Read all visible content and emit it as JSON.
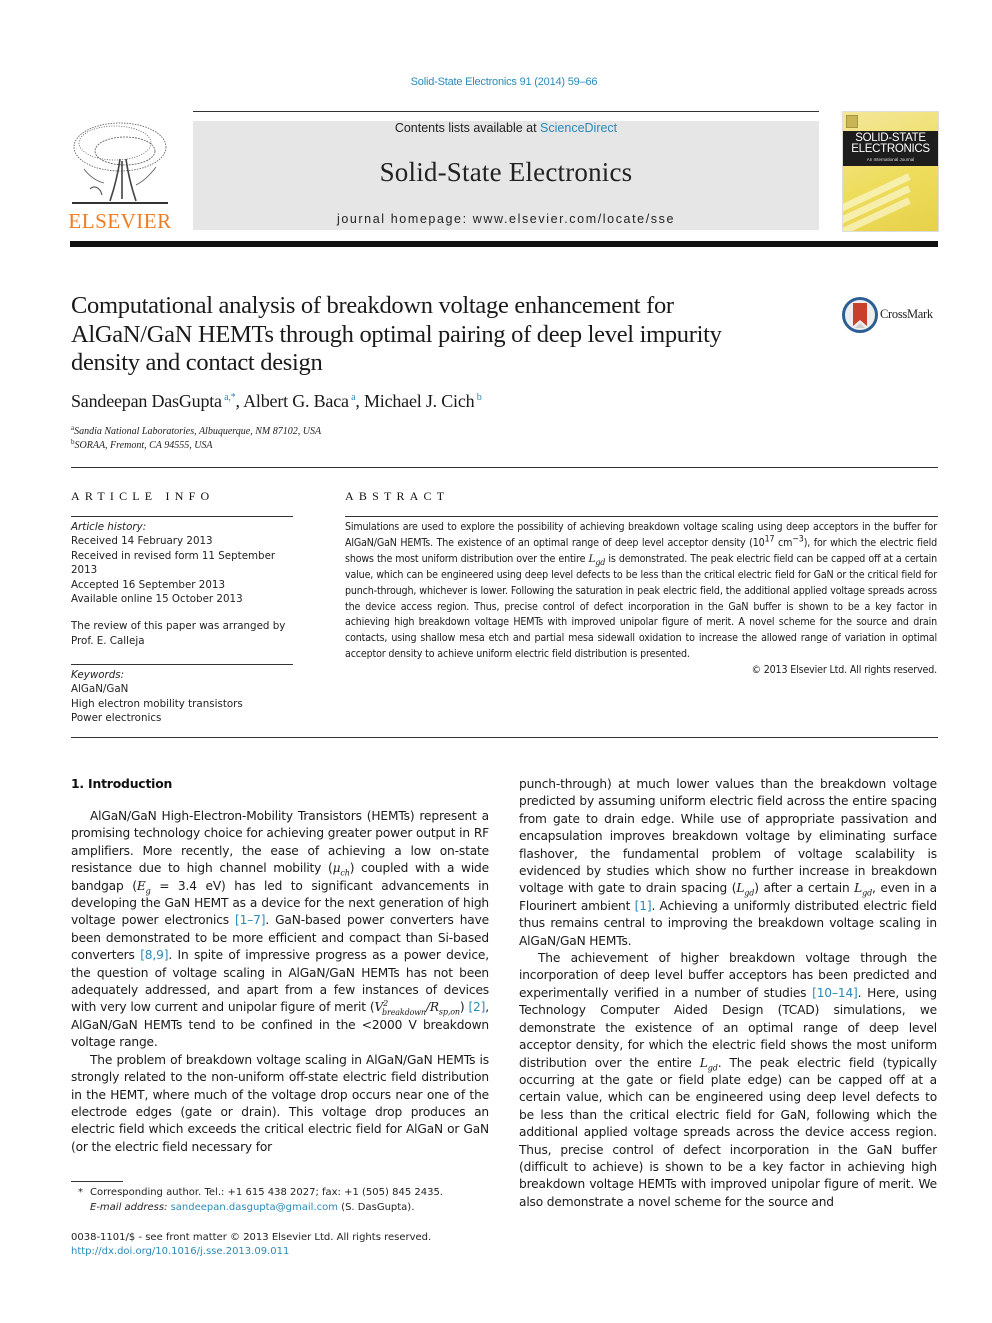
{
  "header": {
    "citation": "Solid-State Electronics 91 (2014) 59–66",
    "contents_prefix": "Contents lists available at ",
    "contents_link": "ScienceDirect",
    "journal_name": "Solid-State Electronics",
    "homepage_prefix": "journal homepage: ",
    "homepage_url": "www.elsevier.com/locate/sse",
    "publisher_logo_text": "ELSEVIER",
    "cover": {
      "title_line1": "SOLID-STATE",
      "title_line2": "ELECTRONICS",
      "subtitle": "An International Journal"
    }
  },
  "article": {
    "title": "Computational analysis of breakdown voltage enhancement for AlGaN/GaN HEMTs through optimal pairing of deep level impurity density and contact design",
    "crossmark_label": "CrossMark",
    "authors": [
      {
        "name": "Sandeepan DasGupta",
        "marks": "a,*"
      },
      {
        "name": "Albert G. Baca",
        "marks": "a"
      },
      {
        "name": "Michael J. Cich",
        "marks": "b"
      }
    ],
    "affiliations": [
      {
        "mark": "a",
        "text": "Sandia National Laboratories, Albuquerque, NM 87102, USA"
      },
      {
        "mark": "b",
        "text": "SORAA, Fremont, CA 94555, USA"
      }
    ]
  },
  "article_info": {
    "heading": "ARTICLE INFO",
    "history_label": "Article history:",
    "history": [
      "Received 14 February 2013",
      "Received in revised form 11 September 2013",
      "Accepted 16 September 2013",
      "Available online 15 October 2013"
    ],
    "review_note": "The review of this paper was arranged by Prof. E. Calleja",
    "keywords_label": "Keywords:",
    "keywords": [
      "AlGaN/GaN",
      "High electron mobility transistors",
      "Power electronics"
    ]
  },
  "abstract": {
    "heading": "ABSTRACT",
    "p1": "Simulations are used to explore the possibility of achieving breakdown voltage scaling using deep acceptors in the buffer for AlGaN/GaN HEMTs. The existence of an optimal range of deep level acceptor density (",
    "density_base": "10",
    "density_exp": "17",
    "density_unit": " cm",
    "density_unit_exp": "−3",
    "p2": "), for which the electric field shows the most uniform distribution over the entire ",
    "lgd_L": "L",
    "lgd_sub": "gd",
    "p3": " is demonstrated. The peak electric field can be capped off at a certain value, which can be engineered using deep level defects to be less than the critical electric field for GaN or the critical field for punch-through, whichever is lower. Following the saturation in peak electric field, the additional applied voltage spreads across the device access region. Thus, precise control of defect incorporation in the GaN buffer is shown to be a key factor in achieving high breakdown voltage HEMTs with improved unipolar figure of merit. A novel scheme for the source and drain contacts, using shallow mesa etch and partial mesa sidewall oxidation to increase the allowed range of variation in optimal acceptor density to achieve uniform electric field distribution is presented.",
    "copyright": "© 2013 Elsevier Ltd. All rights reserved."
  },
  "introduction": {
    "heading": "1. Introduction",
    "left": {
      "p1_a": "AlGaN/GaN High-Electron-Mobility Transistors (HEMTs) represent a promising technology choice for achieving greater power output in RF amplifiers. More recently, the ease of achieving a low on-state resistance due to high channel mobility (",
      "mu": "μ",
      "mu_sub": "ch",
      "p1_b": ") coupled with a wide bandgap (",
      "eg": "E",
      "eg_sub": "g",
      "p1_c": " = 3.4 eV) has led to significant advancements in developing the GaN HEMT as a device for the next generation of high voltage power electronics ",
      "ref1": "[1–7]",
      "p1_d": ". GaN-based power converters have been demonstrated to be more efficient and compact than Si-based converters ",
      "ref2": "[8,9]",
      "p1_e": ". In spite of impressive progress as a power device, the question of voltage scaling in AlGaN/GaN HEMTs has not been adequately addressed, and apart from a few instances of devices with very low current and unipolar figure of merit (",
      "v": "V",
      "v_sup": "2",
      "v_sub": "breakdown",
      "r": "/R",
      "r_sub": "sp,on",
      "p1_f": ") ",
      "ref3": "[2]",
      "p1_g": ", AlGaN/GaN HEMTs tend to be confined in the <2000 V breakdown voltage range.",
      "p2": "The problem of breakdown voltage scaling in AlGaN/GaN HEMTs is strongly related to the non-uniform off-state electric field distribution in the HEMT, where much of the voltage drop occurs near one of the electrode edges (gate or drain). This voltage drop produces an electric field which exceeds the critical electric field for AlGaN or GaN (or the electric field necessary for"
    },
    "right": {
      "p1_a": "punch-through) at much lower values than the breakdown voltage predicted by assuming uniform electric field across the entire spacing from gate to drain edge. While use of appropriate passivation and encapsulation improves breakdown voltage by eliminating surface flashover, the fundamental problem of voltage scalability is evidenced by studies which show no further increase in breakdown voltage with gate to drain spacing (",
      "lgd": "L",
      "lgd_sub": "gd",
      "p1_b": ") after a certain ",
      "p1_c": ", even in a Flourinert ambient ",
      "ref1": "[1]",
      "p1_d": ". Achieving a uniformly distributed electric field thus remains central to improving the breakdown voltage scaling in AlGaN/GaN HEMTs.",
      "p2_a": "The achievement of higher breakdown voltage through the incorporation of deep level buffer acceptors has been predicted and experimentally verified in a number of studies ",
      "ref2": "[10–14]",
      "p2_b": ". Here, using Technology Computer Aided Design (TCAD) simulations, we demonstrate the existence of an optimal range of deep level acceptor density, for which the electric field shows the most uniform distribution over the entire ",
      "p2_c": ". The peak electric field (typically occurring at the gate or field plate edge) can be capped off at a certain value, which can be engineered using deep level defects to be less than the critical electric field for GaN, following which the additional applied voltage spreads across the device access region. Thus, precise control of defect incorporation in the GaN buffer (difficult to achieve) is shown to be a key factor in achieving high breakdown voltage HEMTs with improved unipolar figure of merit. We also demonstrate a novel scheme for the source and"
    }
  },
  "footnotes": {
    "star": "*",
    "corresponding": "Corresponding author. Tel.: +1 615 438 2027; fax: +1 (505) 845 2435.",
    "email_label": "E-mail address: ",
    "email": "sandeepan.dasgupta@gmail.com",
    "email_suffix": " (S. DasGupta).",
    "front_matter": "0038-1101/$ - see front matter © 2013 Elsevier Ltd. All rights reserved.",
    "doi": "http://dx.doi.org/10.1016/j.sse.2013.09.011"
  }
}
